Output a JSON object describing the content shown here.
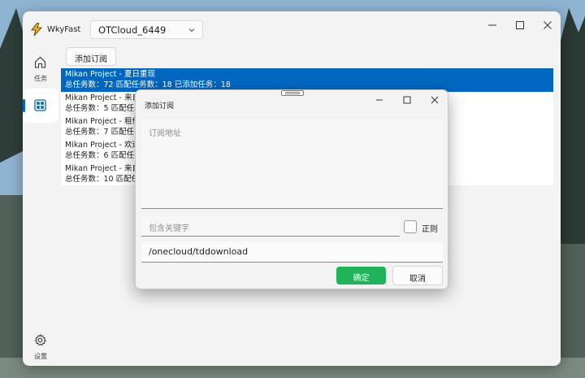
{
  "app": {
    "title": "WkyFast"
  },
  "account": {
    "selected": "OTCloud_6449"
  },
  "sidebar": {
    "items": [
      {
        "label": "任务",
        "icon": "home-icon"
      },
      {
        "label": "",
        "icon": "grid-icon"
      },
      {
        "label": "设置",
        "icon": "gear-icon"
      }
    ]
  },
  "toolbar": {
    "add_subscription_label": "添加订阅"
  },
  "subscriptions": [
    {
      "line1": "Mikan Project - 夏日重现",
      "line2": "总任务数：72   匹配任务数：18   已添加任务：18"
    },
    {
      "line1": "Mikan Project - 来自",
      "line2": "总任务数：5   匹配任"
    },
    {
      "line1": "Mikan Project - 租借",
      "line2": "总任务数：7   匹配任"
    },
    {
      "line1": "Mikan Project - 欢迎",
      "line2": "总任务数：6   匹配任"
    },
    {
      "line1": "Mikan Project - 来自",
      "line2": "总任务数：10   匹配任"
    }
  ],
  "dialog": {
    "title": "添加订阅",
    "url_placeholder": "订阅地址",
    "keyword_placeholder": "包含关键字",
    "regex_label": "正则",
    "path_value": "/onecloud/tddownload",
    "ok_label": "确定",
    "cancel_label": "取消"
  },
  "colors": {
    "accent": "#0067c0",
    "ok_button": "#21b35a",
    "app_icon": "#f2b01e"
  }
}
